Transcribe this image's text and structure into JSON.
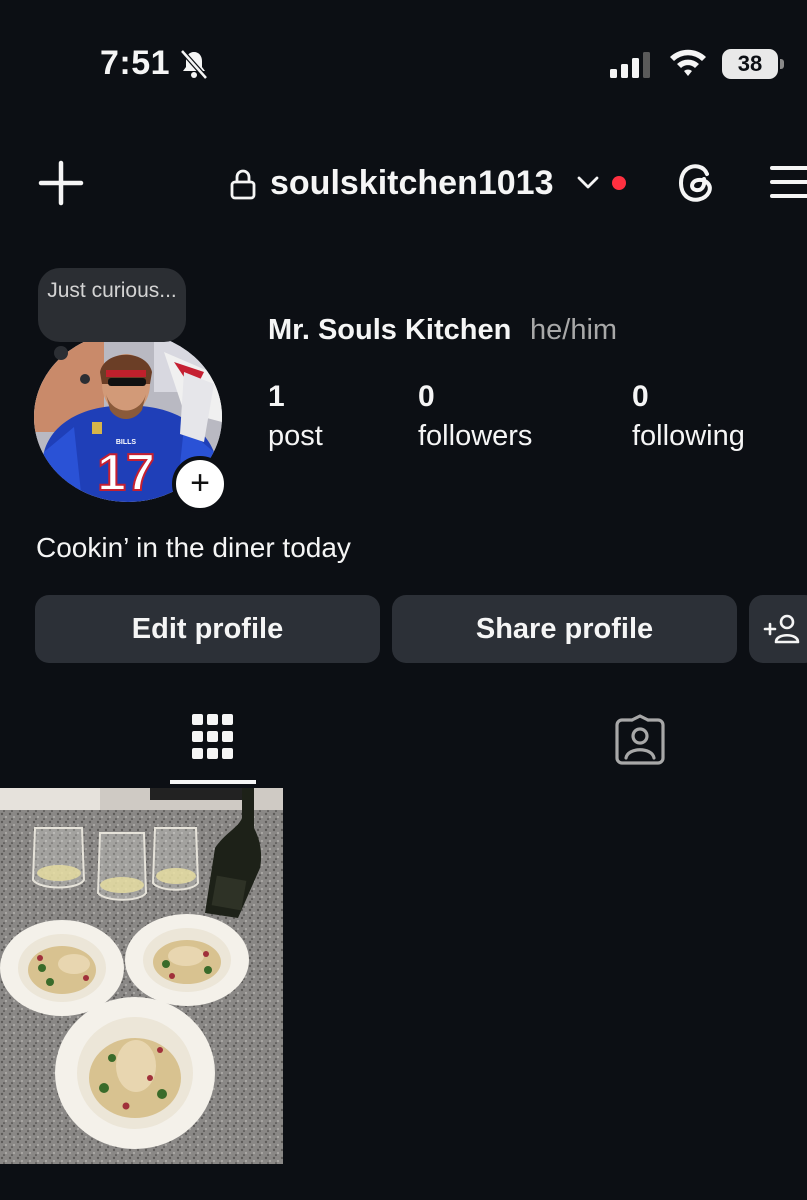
{
  "status_bar": {
    "time": "7:51",
    "battery": "38"
  },
  "header": {
    "username": "soulskitchen1013",
    "accent_dot_color": "#ff3040"
  },
  "profile": {
    "note": "Just curious...",
    "display_name": "Mr. Souls Kitchen",
    "pronouns": "he/him",
    "stats": [
      {
        "value": "1",
        "label": "post"
      },
      {
        "value": "0",
        "label": "followers"
      },
      {
        "value": "0",
        "label": "following"
      }
    ],
    "bio": "Cookin’ in the diner today",
    "jersey_number": "17",
    "jersey_text": "BILLS"
  },
  "actions": {
    "edit_profile": "Edit profile",
    "share_profile": "Share profile"
  },
  "tabs": [
    {
      "icon": "grid-icon",
      "selected": true
    },
    {
      "icon": "tagged-icon",
      "selected": false
    }
  ],
  "posts": [
    {
      "description_icon": "food-plates-photo"
    }
  ]
}
